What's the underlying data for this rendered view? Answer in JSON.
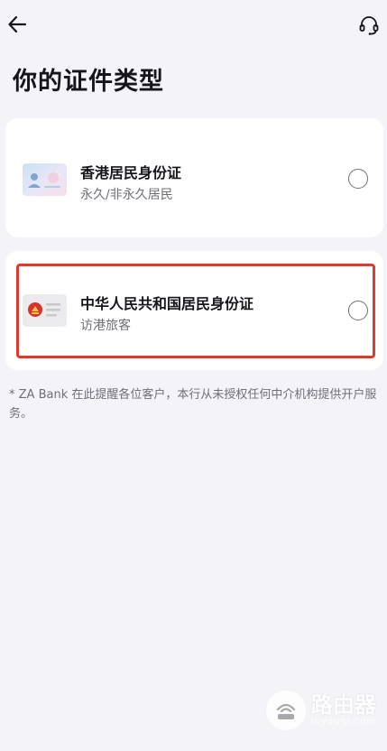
{
  "header": {
    "back_icon": "arrow-left-icon",
    "support_icon": "headset-icon"
  },
  "title": "你的证件类型",
  "options": [
    {
      "title": "香港居民身份证",
      "subtitle": "永久/非永久居民",
      "icon": "hk-id-card-icon",
      "selected": false
    },
    {
      "title": "中华人民共和国居民身份证",
      "subtitle": "访港旅客",
      "icon": "prc-id-card-icon",
      "selected": false,
      "highlighted": true
    }
  ],
  "disclaimer": "* ZA Bank 在此提醒各位客户，本行从未授权任何中介机构提供开户服务。",
  "watermark": {
    "name": "路由器",
    "domain": "luyouqi.com"
  },
  "colors": {
    "background": "#f4f3f8",
    "card": "#ffffff",
    "highlight": "#de3b2e",
    "text_primary": "#16161a",
    "text_secondary": "#6f6f78"
  }
}
